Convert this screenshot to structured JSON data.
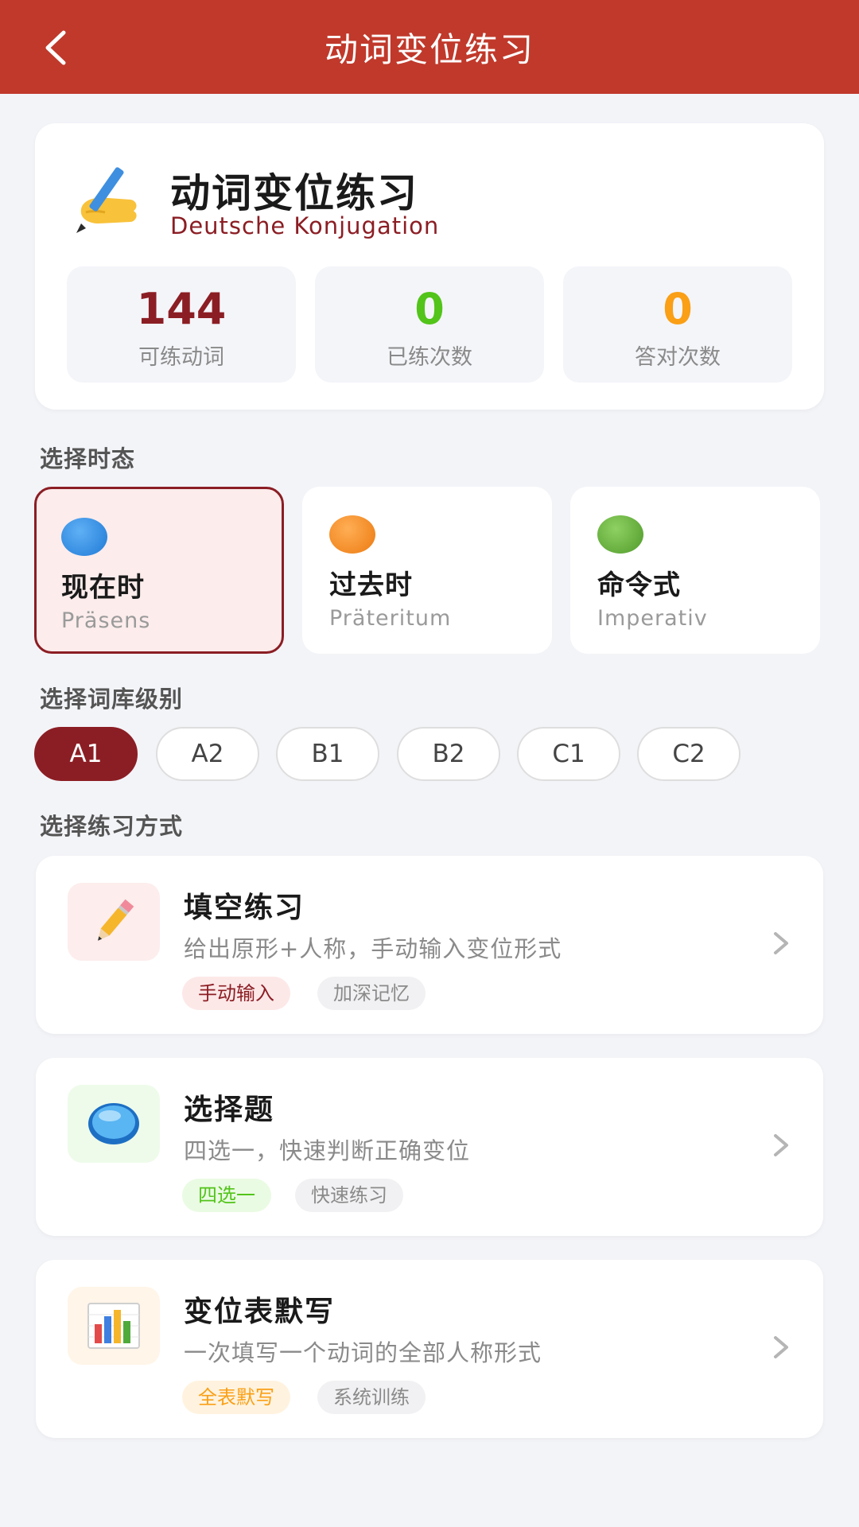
{
  "header": {
    "title": "动词变位练习"
  },
  "intro": {
    "title": "动词变位练习",
    "subtitle": "Deutsche Konjugation",
    "stats": [
      {
        "value": "144",
        "label": "可练动词",
        "color": "#8b1e24"
      },
      {
        "value": "0",
        "label": "已练次数",
        "color": "#52c41a"
      },
      {
        "value": "0",
        "label": "答对次数",
        "color": "#fa9f16"
      }
    ]
  },
  "tense_section": {
    "label": "选择时态"
  },
  "tenses": [
    {
      "name": "现在时",
      "sub": "Präsens",
      "color": "#2f8ee6",
      "selected": true
    },
    {
      "name": "过去时",
      "sub": "Präteritum",
      "color": "#f5891f",
      "selected": false
    },
    {
      "name": "命令式",
      "sub": "Imperativ",
      "color": "#6aae3b",
      "selected": false
    }
  ],
  "level_section": {
    "label": "选择词库级别"
  },
  "levels": [
    "A1",
    "A2",
    "B1",
    "B2",
    "C1",
    "C2"
  ],
  "selected_level": "A1",
  "mode_section": {
    "label": "选择练习方式"
  },
  "modes": [
    {
      "title": "填空练习",
      "desc": "给出原形+人称，手动输入变位形式",
      "icon": "pencil-icon",
      "icon_bg": "#fdeded",
      "tags": [
        {
          "text": "手动输入",
          "bg": "#fde8e8",
          "color": "#8b1e24"
        },
        {
          "text": "加深记忆",
          "bg": "#f1f1f3",
          "color": "#8a8a8a"
        }
      ]
    },
    {
      "title": "选择题",
      "desc": "四选一，快速判断正确变位",
      "icon": "blue-circle-icon",
      "icon_bg": "#eefbea",
      "tags": [
        {
          "text": "四选一",
          "bg": "#eafbe3",
          "color": "#52c41a"
        },
        {
          "text": "快速练习",
          "bg": "#f1f1f3",
          "color": "#8a8a8a"
        }
      ]
    },
    {
      "title": "变位表默写",
      "desc": "一次填写一个动词的全部人称形式",
      "icon": "bar-chart-icon",
      "icon_bg": "#fff5e8",
      "tags": [
        {
          "text": "全表默写",
          "bg": "#fff3df",
          "color": "#fa9f16"
        },
        {
          "text": "系统训练",
          "bg": "#f1f1f3",
          "color": "#8a8a8a"
        }
      ]
    }
  ]
}
